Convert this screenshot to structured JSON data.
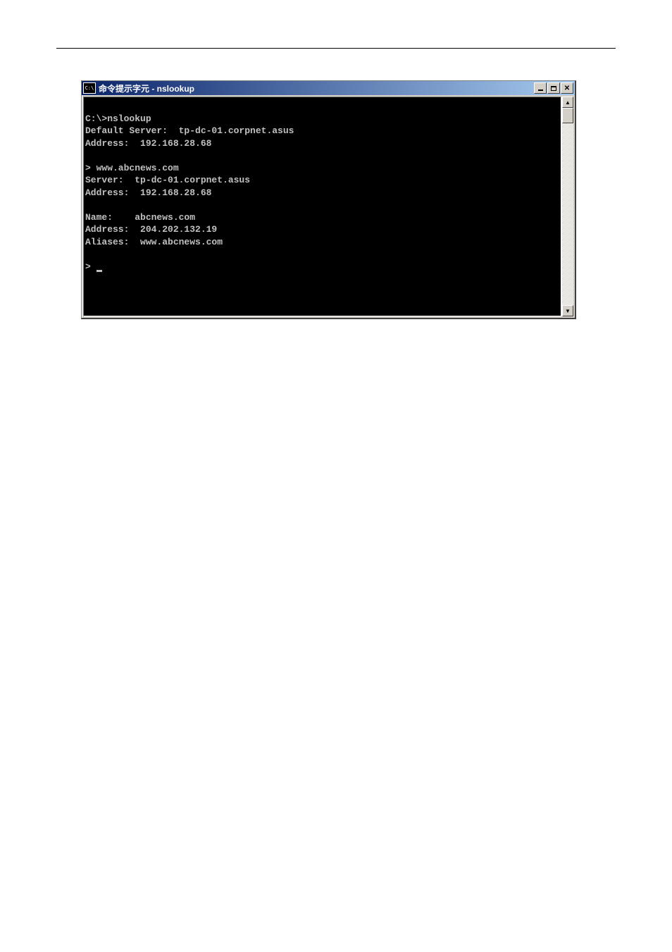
{
  "window": {
    "icon_text": "C:\\",
    "title": "命令提示字元 - nslookup"
  },
  "terminal": {
    "blank1": "",
    "line1": "C:\\>nslookup",
    "line2": "Default Server:  tp-dc-01.corpnet.asus",
    "line3": "Address:  192.168.28.68",
    "blank2": "",
    "line4": "> www.abcnews.com",
    "line5": "Server:  tp-dc-01.corpnet.asus",
    "line6": "Address:  192.168.28.68",
    "blank3": "",
    "line7": "Name:    abcnews.com",
    "line8": "Address:  204.202.132.19",
    "line9": "Aliases:  www.abcnews.com",
    "blank4": "",
    "prompt": "> "
  }
}
